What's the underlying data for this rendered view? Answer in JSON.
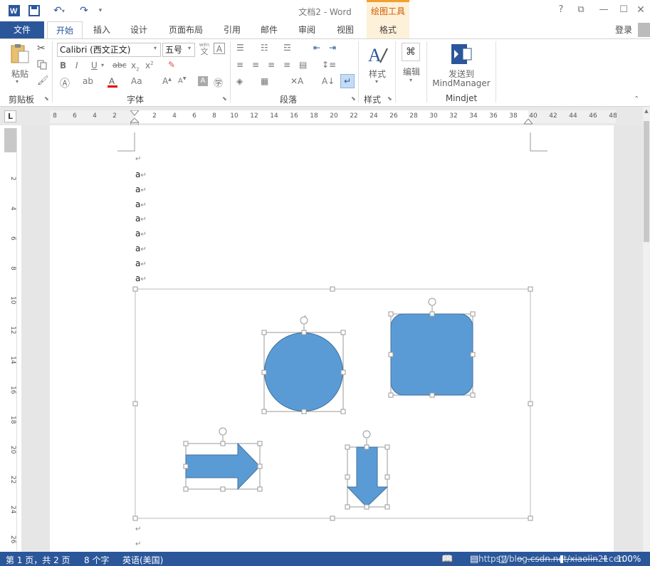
{
  "title_bar": {
    "doc_title": "文档2 - Word",
    "contextual_tab_header": "绘图工具",
    "help": "?",
    "restore": "⧉",
    "minimize": "—",
    "maximize": "☐"
  },
  "tabs": {
    "file": "文件",
    "home": "开始",
    "insert": "插入",
    "design": "设计",
    "layout": "页面布局",
    "references": "引用",
    "mailings": "邮件",
    "review": "审阅",
    "view": "视图",
    "format": "格式",
    "login": "登录"
  },
  "ribbon": {
    "clipboard": {
      "paste": "粘贴",
      "label": "剪贴板"
    },
    "font": {
      "name": "Calibri (西文正文)",
      "size": "五号",
      "label": "字体",
      "wen": "wén",
      "wen_char": "文",
      "A_box": "A"
    },
    "paragraph": {
      "label": "段落"
    },
    "styles": {
      "button": "样式",
      "label": "样式"
    },
    "editing": {
      "button": "编辑"
    },
    "mindjet": {
      "button_line1": "发送到",
      "button_line2": "MindManager",
      "label": "Mindjet"
    }
  },
  "ruler": {
    "corner": "L",
    "h_ticks": [
      "8",
      "6",
      "4",
      "2",
      "2",
      "4",
      "6",
      "8",
      "10",
      "12",
      "14",
      "16",
      "18",
      "20",
      "22",
      "24",
      "26",
      "28",
      "30",
      "32",
      "34",
      "36",
      "38",
      "40",
      "42",
      "44",
      "46",
      "48"
    ],
    "v_ticks": [
      "2",
      "4",
      "6",
      "8",
      "10",
      "12",
      "14",
      "16",
      "18",
      "20",
      "22",
      "24",
      "26"
    ]
  },
  "document": {
    "lines": [
      "a",
      "a",
      "a",
      "a",
      "a",
      "a",
      "a",
      "a"
    ],
    "paragraph_mark": "↵",
    "shapes": [
      {
        "type": "circle",
        "color": "#5b9bd5"
      },
      {
        "type": "rounded-rectangle",
        "color": "#5b9bd5"
      },
      {
        "type": "right-arrow",
        "color": "#5b9bd5"
      },
      {
        "type": "down-arrow",
        "color": "#5b9bd5"
      }
    ]
  },
  "status_bar": {
    "page": "第 1 页，共 2 页",
    "words": "8 个字",
    "language": "英语(美国)",
    "watermark": "https://blog.csdn.net/xiaolin21cen",
    "zoom": "100%"
  },
  "colors": {
    "accent": "#2b579a",
    "shape_fill": "#5b9bd5",
    "contextual": "#f0a030"
  }
}
